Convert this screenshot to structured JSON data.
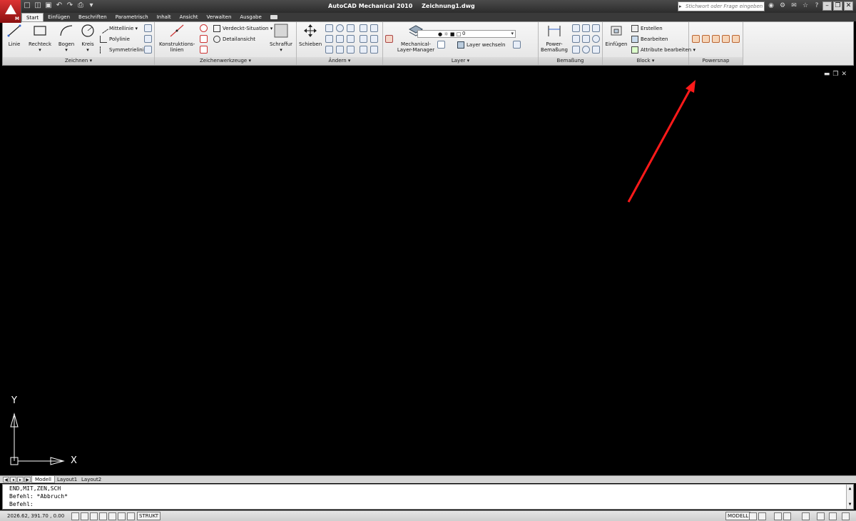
{
  "app": {
    "title": "AutoCAD Mechanical 2010",
    "document": "Zeichnung1.dwg",
    "logo_badge": "M",
    "search_placeholder": "Stichwort oder Frage eingeben"
  },
  "tabs": [
    {
      "label": "Start",
      "active": true
    },
    {
      "label": "Einfügen"
    },
    {
      "label": "Beschriften"
    },
    {
      "label": "Parametrisch"
    },
    {
      "label": "Inhalt"
    },
    {
      "label": "Ansicht"
    },
    {
      "label": "Verwalten"
    },
    {
      "label": "Ausgabe"
    }
  ],
  "ribbon": {
    "zeichnen": {
      "label": "Zeichnen",
      "linie": "Linie",
      "rechteck": "Rechteck",
      "bogen": "Bogen",
      "kreis": "Kreis",
      "mittellinie": "Mittellinie",
      "polylinie": "Polylinie",
      "symmetrielinie": "Symmetrielinie"
    },
    "zeichenwerkzeuge": {
      "label": "Zeichenwerkzeuge",
      "konstruktionslinien_1": "Konstruktions-",
      "konstruktionslinien_2": "linien",
      "verdeckt": "Verdeckt-Situation",
      "detailansicht": "Detailansicht",
      "schraffur": "Schraffur"
    },
    "aendern": {
      "label": "Ändern",
      "schieben": "Schieben"
    },
    "layer": {
      "label": "Layer",
      "manager_1": "Mechanical-",
      "manager_2": "Layer-Manager",
      "current_layer": "0",
      "layer_wechseln": "Layer wechseln"
    },
    "bemassung": {
      "label": "Bemaßung",
      "power_1": "Power-",
      "power_2": "Bemaßung"
    },
    "block": {
      "label": "Block",
      "einfuegen": "Einfügen",
      "erstellen": "Erstellen",
      "bearbeiten": "Bearbeiten",
      "attribute": "Attribute bearbeiten"
    },
    "powersnap": {
      "label": "Powersnap"
    }
  },
  "ucs": {
    "x": "X",
    "y": "Y"
  },
  "layout_tabs": [
    {
      "label": "Modell",
      "active": true
    },
    {
      "label": "Layout1"
    },
    {
      "label": "Layout2"
    }
  ],
  "command": {
    "line1": "END,MIT,ZEN,SCH",
    "line2": "Befehl: *Abbruch*",
    "line3": "Befehl:"
  },
  "status": {
    "coordinates": "2026.62, 391.70 , 0.00",
    "strukt": "STRUKT",
    "modell": "MODELL"
  },
  "colors": {
    "annotation_arrow": "#ff1a1a",
    "canvas": "#000000"
  }
}
